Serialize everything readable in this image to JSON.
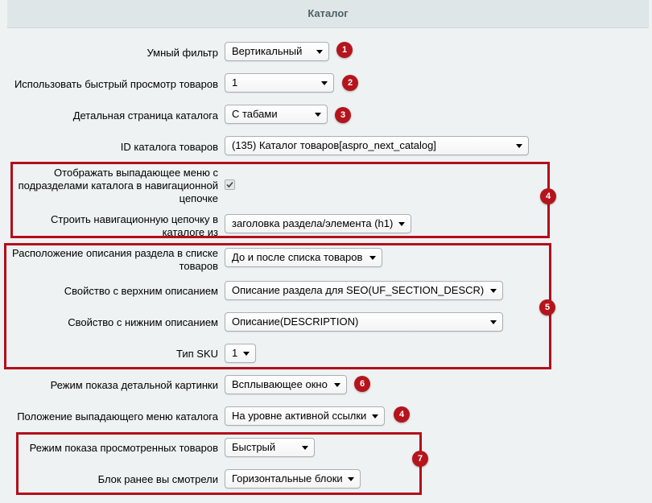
{
  "header": {
    "title": "Каталог"
  },
  "rows": [
    {
      "label": "Умный фильтр",
      "value": "Вертикальный",
      "badge": "1"
    },
    {
      "label": "Использовать быстрый просмотр товаров",
      "value": "1",
      "badge": "2"
    },
    {
      "label": "Детальная страница каталога",
      "value": "С табами",
      "badge": "3"
    },
    {
      "label": "ID каталога товаров",
      "value": "(135) Каталог товаров[aspro_next_catalog]"
    },
    {
      "label": "Отображать выпадающее меню с подразделами каталога в навигационной цепочке",
      "checked": true
    },
    {
      "label": "Строить навигационную цепочку в каталоге из",
      "value": "заголовка раздела/элемента (h1)"
    },
    {
      "label": "Расположение описания раздела в списке товаров",
      "value": "До и после списка товаров"
    },
    {
      "label": "Свойство с верхним описанием",
      "value": "Описание раздела для SEO(UF_SECTION_DESCR)"
    },
    {
      "label": "Свойство с нижним описанием",
      "value": "Описание(DESCRIPTION)"
    },
    {
      "label": "Тип SKU",
      "value": "1"
    },
    {
      "label": "Режим показа детальной картинки",
      "value": "Всплывающее окно",
      "badge": "6"
    },
    {
      "label": "Положение выпадающего меню каталога",
      "value": "На уровне активной ссылки",
      "badge": "4"
    },
    {
      "label": "Режим показа просмотренных товаров",
      "value": "Быстрый"
    },
    {
      "label": "Блок ранее вы смотрели",
      "value": "Горизонтальные блоки"
    }
  ],
  "group_badges": {
    "nav_group": "4",
    "description_group": "5",
    "viewed_group": "7"
  },
  "colors": {
    "badge": "#b5141d",
    "highlight_box": "#b30e1a",
    "header_bg": "#dfe6e8",
    "page_bg": "#eef2f3"
  }
}
